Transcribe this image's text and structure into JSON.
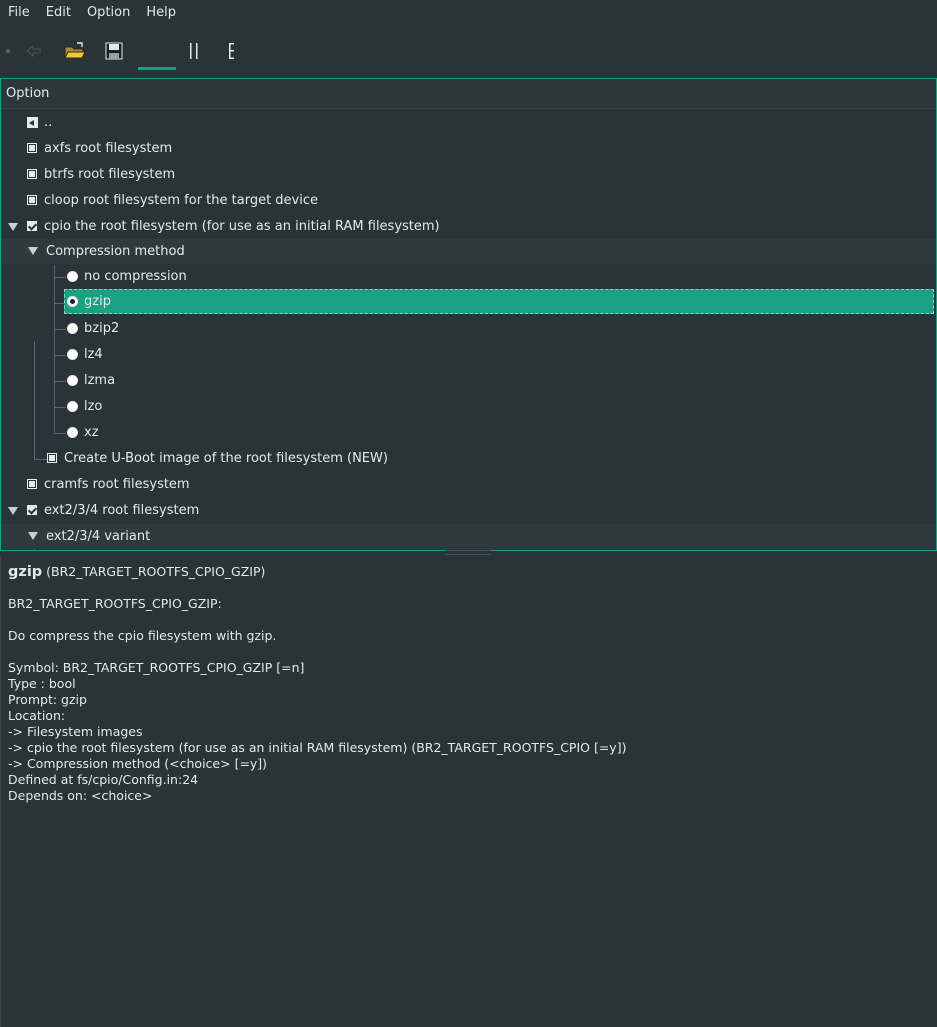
{
  "menubar": {
    "items": [
      "File",
      "Edit",
      "Option",
      "Help"
    ]
  },
  "toolbar": {
    "buttons": [
      "back-icon",
      "open-folder-icon",
      "save-icon",
      "single-view-icon",
      "split-view-icon",
      "full-tree-view-icon"
    ],
    "accent": "#1aa083"
  },
  "tree": {
    "header": "Option",
    "rows": [
      {
        "label": "..",
        "kind": "back"
      },
      {
        "label": "axfs root filesystem",
        "kind": "checkbox",
        "checked": false
      },
      {
        "label": "btrfs root filesystem",
        "kind": "checkbox",
        "checked": false
      },
      {
        "label": "cloop root filesystem for the target device",
        "kind": "checkbox",
        "checked": false
      },
      {
        "label": "cpio the root filesystem (for use as an initial RAM filesystem)",
        "kind": "checkbox",
        "checked": true,
        "expanded": true
      },
      {
        "label": "Compression method",
        "kind": "group",
        "expanded": true
      },
      {
        "label": "no compression",
        "kind": "radio",
        "selected": false
      },
      {
        "label": "gzip",
        "kind": "radio",
        "selected": true,
        "highlighted": true
      },
      {
        "label": "bzip2",
        "kind": "radio",
        "selected": false
      },
      {
        "label": "lz4",
        "kind": "radio",
        "selected": false
      },
      {
        "label": "lzma",
        "kind": "radio",
        "selected": false
      },
      {
        "label": "lzo",
        "kind": "radio",
        "selected": false
      },
      {
        "label": "xz",
        "kind": "radio",
        "selected": false
      },
      {
        "label": "Create U-Boot image of the root filesystem (NEW)",
        "kind": "checkbox",
        "checked": false
      },
      {
        "label": "cramfs root filesystem",
        "kind": "checkbox",
        "checked": false
      },
      {
        "label": "ext2/3/4 root filesystem",
        "kind": "checkbox",
        "checked": true,
        "expanded": true
      },
      {
        "label": "ext2/3/4 variant",
        "kind": "group",
        "expanded": true
      }
    ]
  },
  "info": {
    "title_name": "gzip",
    "title_symbol": " (BR2_TARGET_ROOTFS_CPIO_GZIP)",
    "symbol_heading": "BR2_TARGET_ROOTFS_CPIO_GZIP:",
    "help": "Do compress the cpio filesystem with gzip.",
    "details": [
      "Symbol: BR2_TARGET_ROOTFS_CPIO_GZIP [=n]",
      "Type : bool",
      "Prompt: gzip",
      "Location:",
      "-> Filesystem images",
      "-> cpio the root filesystem (for use as an initial RAM filesystem) (BR2_TARGET_ROOTFS_CPIO [=y])",
      "-> Compression method (<choice> [=y])",
      "Defined at fs/cpio/Config.in:24",
      "Depends on: <choice>"
    ]
  }
}
